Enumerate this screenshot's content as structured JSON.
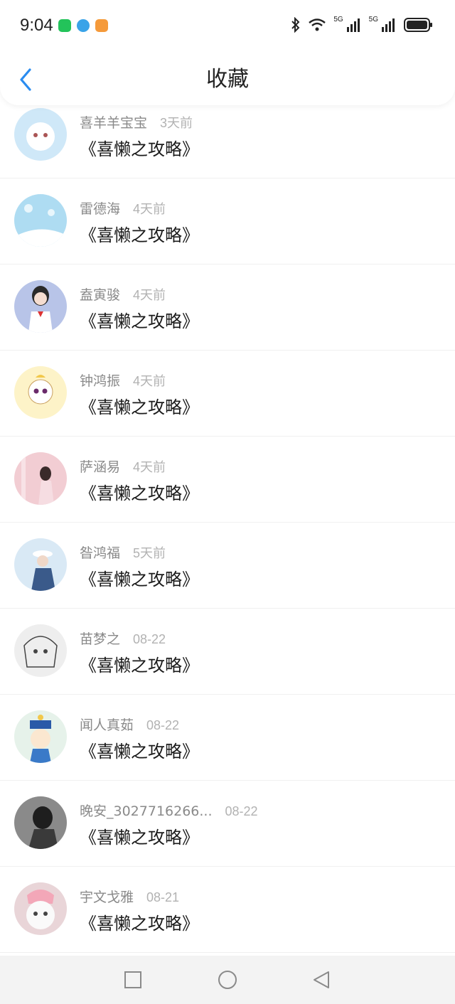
{
  "status_bar": {
    "time": "9:04",
    "signal_label_1": "5G",
    "signal_label_2": "5G",
    "app_icons": [
      "wechat-icon",
      "browser-icon",
      "video-icon"
    ],
    "right_icons": [
      "bluetooth-icon",
      "wifi-icon",
      "signal-icon",
      "signal-icon",
      "battery-icon"
    ]
  },
  "header": {
    "title": "收藏",
    "back_icon": "chevron-left-icon"
  },
  "colors": {
    "accent": "#2a8cf0",
    "name": "#8a8a8a",
    "time": "#b2b2b2",
    "title": "#1a1a1a"
  },
  "items": [
    {
      "name": "喜羊羊宝宝",
      "time": "3天前",
      "title": "《喜懒之攻略》",
      "avatar_color": "#cfe8f8"
    },
    {
      "name": "雷德海",
      "time": "4天前",
      "title": "《喜懒之攻略》",
      "avatar_color": "#aedcf2"
    },
    {
      "name": "盍寅骏",
      "time": "4天前",
      "title": "《喜懒之攻略》",
      "avatar_color": "#b8c4e8"
    },
    {
      "name": "钟鸿振",
      "time": "4天前",
      "title": "《喜懒之攻略》",
      "avatar_color": "#fdf3c8"
    },
    {
      "name": "萨涵易",
      "time": "4天前",
      "title": "《喜懒之攻略》",
      "avatar_color": "#f2cdd3"
    },
    {
      "name": "昝鸿福",
      "time": "5天前",
      "title": "《喜懒之攻略》",
      "avatar_color": "#d9e9f5"
    },
    {
      "name": "苗梦之",
      "time": "08-22",
      "title": "《喜懒之攻略》",
      "avatar_color": "#eeeeee"
    },
    {
      "name": "闻人真茹",
      "time": "08-22",
      "title": "《喜懒之攻略》",
      "avatar_color": "#e6f2ea"
    },
    {
      "name": "晚安_3027716266...",
      "time": "08-22",
      "title": "《喜懒之攻略》",
      "avatar_color": "#8a8a8a"
    },
    {
      "name": "宇文戈雅",
      "time": "08-21",
      "title": "《喜懒之攻略》",
      "avatar_color": "#e9d5d8"
    }
  ],
  "nav_bar": {
    "buttons": [
      "recent-apps-icon",
      "home-icon",
      "back-icon"
    ]
  }
}
